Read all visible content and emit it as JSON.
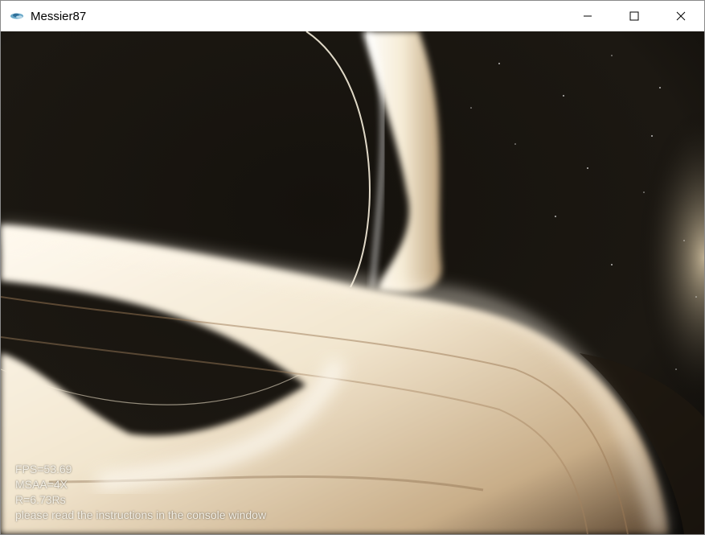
{
  "window": {
    "title": "Messier87",
    "app_icon": "galaxy-icon",
    "controls": {
      "minimize_icon": "minimize-icon",
      "maximize_icon": "maximize-icon",
      "close_icon": "close-icon"
    }
  },
  "overlay": {
    "fps": "FPS=53.69",
    "msaa": "MSAA=4X",
    "radius": "R=6.73Rs",
    "instructions": "please read the instructions in the console window"
  },
  "colors": {
    "space": "#000000",
    "disk": "#f3ead6",
    "disk_shadow": "#8a6a45",
    "titlebar": "#ffffff"
  }
}
